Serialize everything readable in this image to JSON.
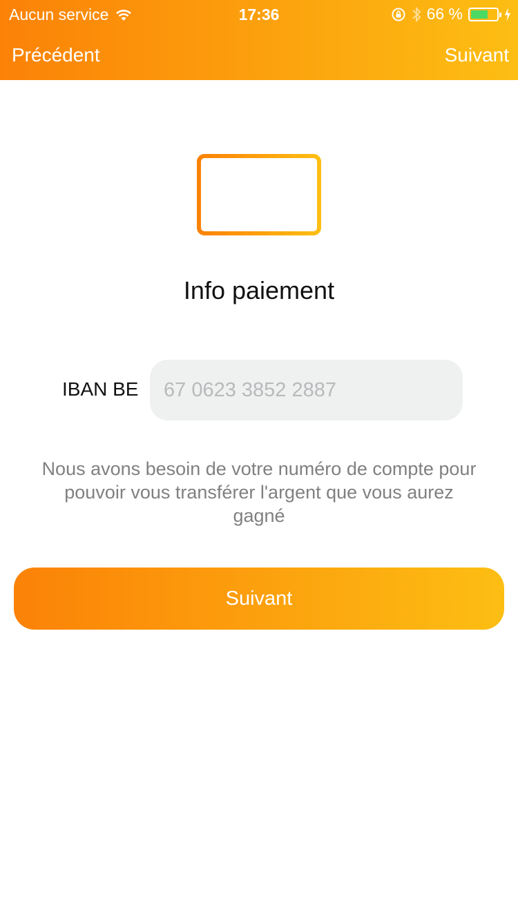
{
  "status_bar": {
    "carrier": "Aucun service",
    "time": "17:36",
    "battery": "66 %",
    "battery_level": 0.66
  },
  "nav": {
    "back_label": "Précédent",
    "next_label": "Suivant"
  },
  "main": {
    "title": "Info paiement",
    "iban_label": "IBAN BE",
    "iban_placeholder": "67 0623 3852 2887",
    "iban_value": "",
    "description": "Nous avons besoin de votre numéro de compte pour pouvoir vous transférer l'argent que vous aurez gagné",
    "primary_button_label": "Suivant"
  },
  "icons": {
    "header": "credit-card-icon",
    "wifi": "wifi-icon",
    "rotation_lock": "rotation-lock-icon",
    "bluetooth": "bluetooth-icon",
    "charging": "charging-bolt-icon"
  },
  "colors": {
    "accent_start": "#fb8207",
    "accent_end": "#fdbe13",
    "input_bg": "#eff0f0",
    "battery_fill": "#4cd964"
  }
}
